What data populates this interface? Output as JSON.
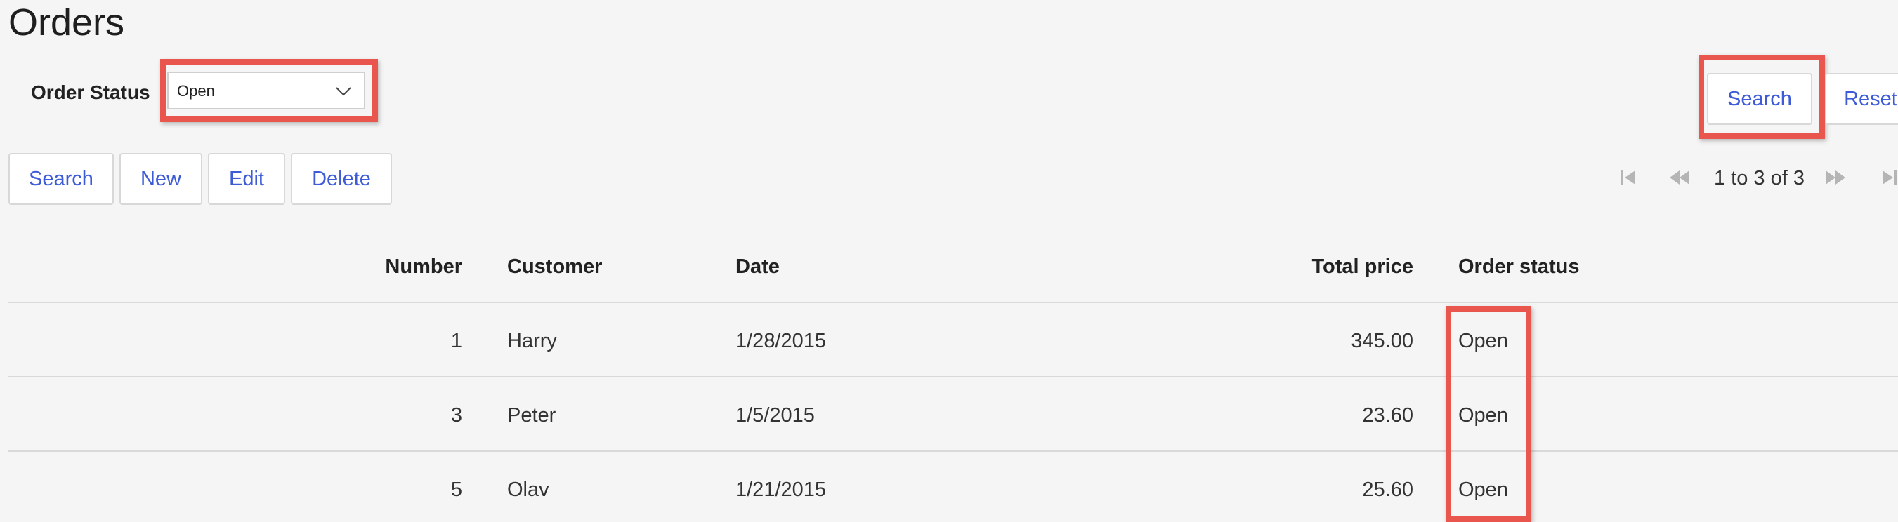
{
  "page": {
    "title": "Orders"
  },
  "filter": {
    "label": "Order Status",
    "selected": "Open",
    "search_label": "Search",
    "reset_label": "Reset"
  },
  "toolbar": {
    "search_label": "Search",
    "new_label": "New",
    "edit_label": "Edit",
    "delete_label": "Delete"
  },
  "pager": {
    "summary": "1 to 3 of 3"
  },
  "table": {
    "columns": [
      "Number",
      "Customer",
      "Date",
      "Total price",
      "Order status"
    ],
    "rows": [
      {
        "number": "1",
        "customer": "Harry",
        "date": "1/28/2015",
        "total": "345.00",
        "status": "Open"
      },
      {
        "number": "3",
        "customer": "Peter",
        "date": "1/5/2015",
        "total": "23.60",
        "status": "Open"
      },
      {
        "number": "5",
        "customer": "Olav",
        "date": "1/21/2015",
        "total": "25.60",
        "status": "Open"
      }
    ]
  },
  "colors": {
    "accent": "#3d5bd6",
    "highlight": "#e8564e",
    "background": "#f5f5f5"
  }
}
